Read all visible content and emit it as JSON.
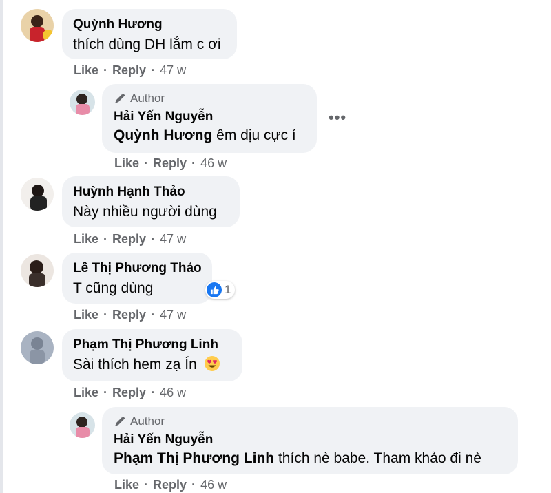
{
  "colors": {
    "bubble": "#f0f2f5",
    "secondary_text": "#65676b",
    "like_blue": "#1877f2"
  },
  "comments": [
    {
      "author": "Quỳnh Hương",
      "text": "thích dùng DH lắm c ơi",
      "actions": {
        "like": "Like",
        "reply": "Reply",
        "time": "47 w"
      }
    },
    {
      "badge": "Author",
      "author": "Hải Yến Nguyễn",
      "mention": "Quỳnh Hương",
      "text": "êm dịu cực í",
      "more": "•••",
      "actions": {
        "like": "Like",
        "reply": "Reply",
        "time": "46 w"
      }
    },
    {
      "author": "Huỳnh Hạnh Thảo",
      "text": "Này nhiều người dùng",
      "actions": {
        "like": "Like",
        "reply": "Reply",
        "time": "47 w"
      }
    },
    {
      "author": "Lê Thị Phương Thảo",
      "text": "T cũng dùng",
      "reaction_count": "1",
      "reaction_icon": "like-icon",
      "actions": {
        "like": "Like",
        "reply": "Reply",
        "time": "47 w"
      }
    },
    {
      "author": "Phạm Thị Phương Linh",
      "text": "Sài thích hem zạ Ín",
      "emoji": "heart-eyes-emoji",
      "actions": {
        "like": "Like",
        "reply": "Reply",
        "time": "46 w"
      }
    },
    {
      "badge": "Author",
      "author": "Hải Yến Nguyễn",
      "mention": "Phạm Thị Phương Linh",
      "text": "thích nè babe. Tham khảo đi nè",
      "actions": {
        "like": "Like",
        "reply": "Reply",
        "time": "46 w"
      }
    }
  ]
}
